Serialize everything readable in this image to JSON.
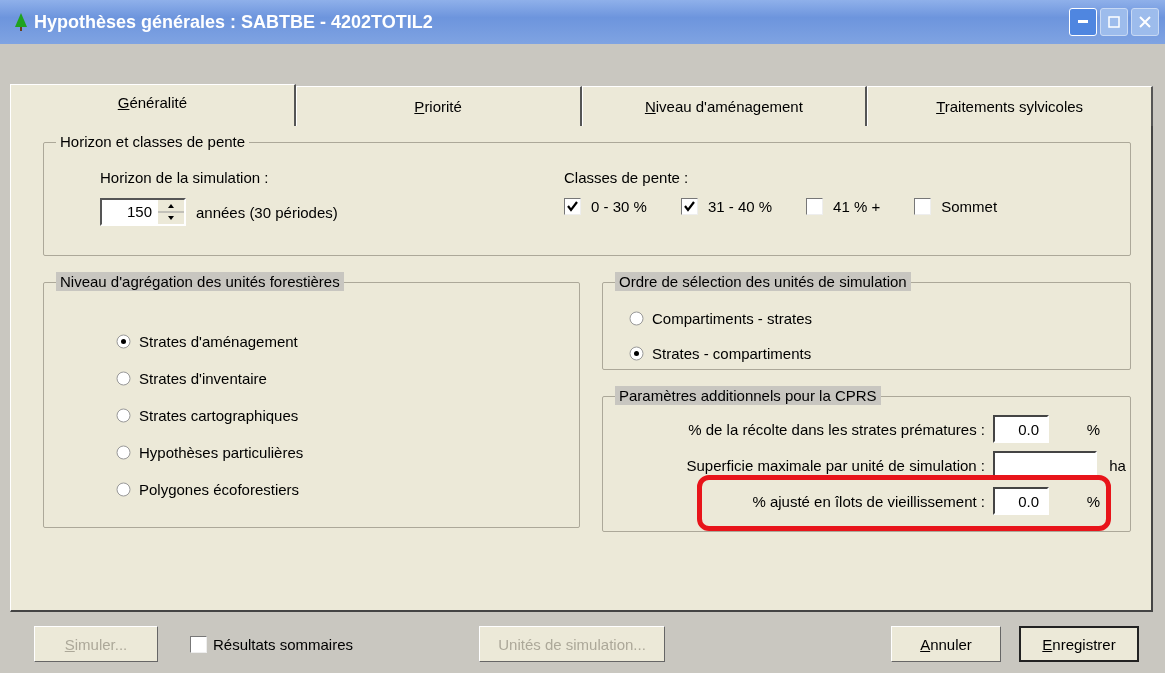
{
  "window": {
    "title": "Hypothèses générales : SABTBE - 4202TOTIL2"
  },
  "tabs": [
    {
      "label": "Généralité",
      "selected": true
    },
    {
      "label": "Priorité",
      "selected": false
    },
    {
      "label": "Niveau d'aménagement",
      "selected": false
    },
    {
      "label": "Traitements sylvicoles",
      "selected": false
    }
  ],
  "horizon_group": {
    "title": "Horizon et classes de pente",
    "shaded": false,
    "horizon_label": "Horizon de la simulation :",
    "horizon_value": "150",
    "horizon_note": "années (30 périodes)",
    "slope_label": "Classes de pente :",
    "slope_classes": [
      {
        "label": "0 - 30 %",
        "checked": true
      },
      {
        "label": "31 - 40 %",
        "checked": true
      },
      {
        "label": "41 % +",
        "checked": false
      },
      {
        "label": "Sommet",
        "checked": false
      }
    ]
  },
  "aggregation_group": {
    "title": "Niveau d'agrégation des unités forestières",
    "shaded": true,
    "options": [
      {
        "label": "Strates d'aménagement",
        "selected": true
      },
      {
        "label": "Strates d'inventaire",
        "selected": false
      },
      {
        "label": "Strates cartographiques",
        "selected": false
      },
      {
        "label": "Hypothèses particulières",
        "selected": false
      },
      {
        "label": "Polygones écoforestiers",
        "selected": false
      }
    ]
  },
  "order_group": {
    "title": "Ordre de sélection des unités de simulation",
    "shaded": true,
    "options": [
      {
        "label": "Compartiments - strates",
        "selected": false
      },
      {
        "label": "Strates - compartiments",
        "selected": true
      }
    ]
  },
  "cprs_group": {
    "title": "Paramètres additionnels pour la CPRS",
    "shaded": true,
    "fields": [
      {
        "label": "% de la récolte dans les strates prématures :",
        "value": "0.0",
        "unit": "%",
        "highlighted": false
      },
      {
        "label": "Superficie maximale par unité de simulation :",
        "unit": "ha",
        "highlighted": false
      },
      {
        "label": "% ajusté en îlots de vieillissement :",
        "value": "0.0",
        "unit": "%",
        "highlighted": true
      }
    ]
  },
  "footer": {
    "simulate_button": {
      "label": "Simuler...",
      "disabled": true
    },
    "summary_checkbox": {
      "label": "Résultats sommaires",
      "checked": false
    },
    "units_button": {
      "label": "Unités de simulation...",
      "disabled": true
    },
    "buttons": [
      {
        "label": "Annuler",
        "default": false
      },
      {
        "label": "Enregistrer",
        "default": true
      }
    ]
  }
}
